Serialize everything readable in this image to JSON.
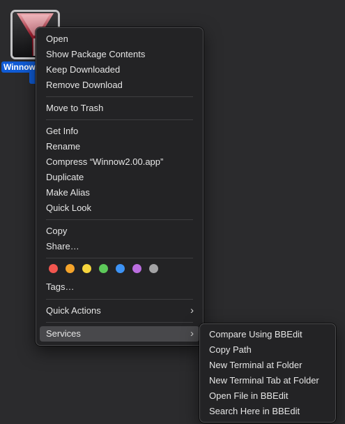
{
  "desktop": {
    "file_name_visible": "Winnow"
  },
  "context_menu": {
    "group1": [
      "Open",
      "Show Package Contents",
      "Keep Downloaded",
      "Remove Download"
    ],
    "group2": [
      "Move to Trash"
    ],
    "group3": [
      "Get Info",
      "Rename",
      "Compress “Winnow2.00.app”",
      "Duplicate",
      "Make Alias",
      "Quick Look"
    ],
    "group4": [
      "Copy",
      "Share…"
    ],
    "tag_colors": [
      {
        "name": "red",
        "hex": "#f2564f"
      },
      {
        "name": "orange",
        "hex": "#f5a42b"
      },
      {
        "name": "yellow",
        "hex": "#f6d53d"
      },
      {
        "name": "green",
        "hex": "#5dc95a"
      },
      {
        "name": "blue",
        "hex": "#3d93f5"
      },
      {
        "name": "purple",
        "hex": "#bb6ee0"
      },
      {
        "name": "gray",
        "hex": "#a3a3a5"
      }
    ],
    "tags_label": "Tags…",
    "quick_actions_label": "Quick Actions",
    "services_label": "Services",
    "chevron_icon": "chevron-right-icon"
  },
  "services_submenu": {
    "items": [
      "Compare Using BBEdit",
      "Copy Path",
      "New Terminal at Folder",
      "New Terminal Tab at Folder",
      "Open File in BBEdit",
      "Search Here in BBEdit"
    ]
  },
  "colors": {
    "background": "#2b2b2d",
    "menu_background": "#232325",
    "highlight": "#48484b",
    "selection": "#0f5bd5",
    "text": "#e6e6e6"
  }
}
